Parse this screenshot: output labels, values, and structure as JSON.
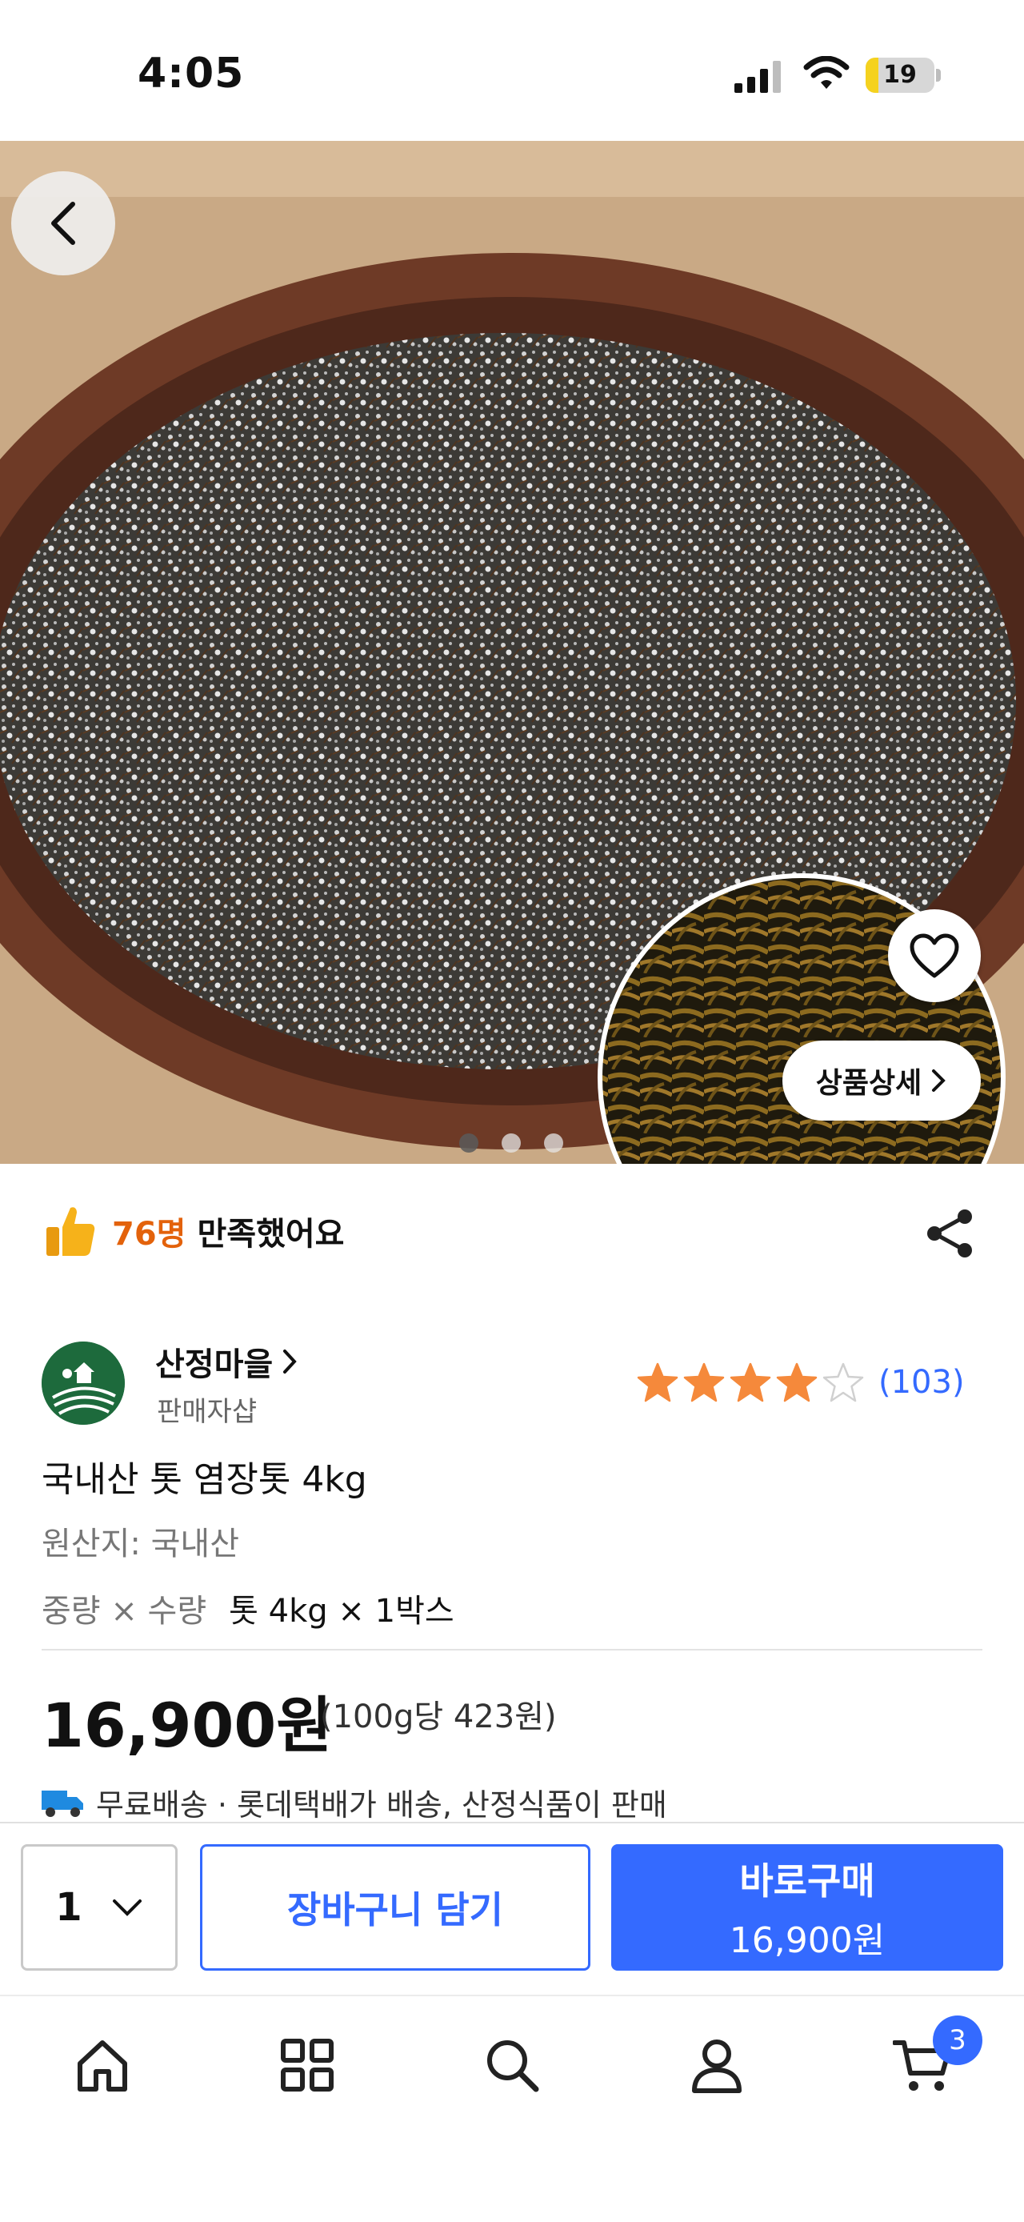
{
  "status_bar": {
    "time": "4:05",
    "battery": "19",
    "battery_level": 0.19
  },
  "hero": {
    "image_count": 3,
    "active_index": 0,
    "detail_button_label": "상품상세"
  },
  "satisfaction": {
    "count": "76명",
    "text": "만족했어요"
  },
  "seller": {
    "name": "산정마을",
    "type": "판매자샵"
  },
  "rating": {
    "stars": 4,
    "max": 5,
    "count": "(103)"
  },
  "product": {
    "title": "국내산 톳 염장톳 4kg",
    "origin": "원산지: 국내산",
    "weight_qty_label": "중량 × 수량",
    "weight_qty_value": "톳 4kg × 1박스",
    "price": "16,900원",
    "unit_price": "(100g당 423원)",
    "delivery": "무료배송 · 롯데택배가 배송, 산정식품이 판매"
  },
  "actions": {
    "quantity": "1",
    "add_to_cart": "장바구니 담기",
    "buy_now": "바로구매",
    "buy_now_price": "16,900원"
  },
  "tabbar": {
    "items": [
      "home-icon",
      "categories-icon",
      "search-icon",
      "my-account-icon",
      "cart-icon"
    ],
    "cart_count": "3"
  },
  "colors": {
    "accent": "#346aff",
    "star": "#f5893b",
    "satisfaction": "#e3620b"
  }
}
